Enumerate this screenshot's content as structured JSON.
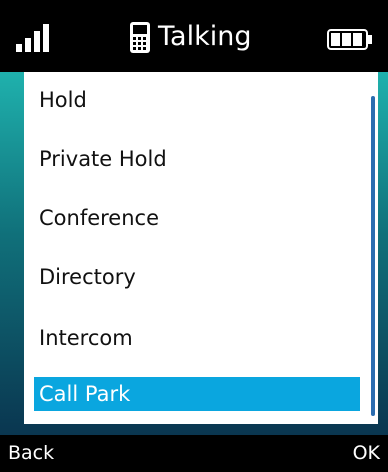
{
  "status_bar": {
    "title": "Talking",
    "signal_icon": "signal-icon",
    "phone_icon": "phone-icon",
    "battery_icon": "battery-icon"
  },
  "menu": {
    "items": [
      {
        "label": "Hold",
        "selected": false
      },
      {
        "label": "Private Hold",
        "selected": false
      },
      {
        "label": "Conference",
        "selected": false
      },
      {
        "label": "Directory",
        "selected": false
      },
      {
        "label": "Intercom",
        "selected": false
      },
      {
        "label": "Call Park",
        "selected": true
      }
    ]
  },
  "softkeys": {
    "left": "Back",
    "right": "OK"
  },
  "colors": {
    "selection": "#0aa6df",
    "scrollbar": "#2b6db0",
    "background_top": "#1fb1ad",
    "background_bottom": "#0a3650"
  }
}
